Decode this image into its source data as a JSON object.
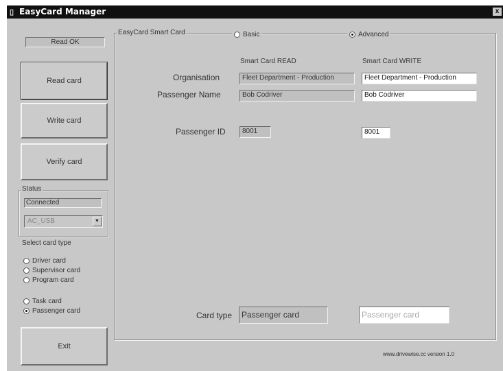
{
  "window": {
    "title": "EasyCard Manager",
    "close_glyph": "x",
    "app_icon": "card-icon"
  },
  "left_panel": {
    "status_line": "Read OK",
    "buttons": {
      "read": "Read card",
      "write": "Write card",
      "verify": "Verify card",
      "exit": "Exit"
    },
    "status_group": {
      "title": "Status",
      "connection": "Connected",
      "port": "AC_USB"
    },
    "card_type_group": {
      "title": "Select card type",
      "options": [
        "Driver card",
        "Supervisor card",
        "Program card",
        "Task card",
        "Passenger card"
      ],
      "selected": "Passenger card"
    }
  },
  "main": {
    "group_title": "EasyCard Smart Card",
    "mode": {
      "basic": "Basic",
      "advanced": "Advanced",
      "selected": "Advanced"
    },
    "col_read": "Smart Card READ",
    "col_write": "Smart Card WRITE",
    "organisation": {
      "label": "Organisation",
      "read": "Fleet Department - Production",
      "write": "Fleet Department - Production"
    },
    "passenger_name": {
      "label": "Passenger Name",
      "read": "Bob Codriver",
      "write": "Bob Codriver"
    },
    "passenger_id": {
      "label": "Passenger ID",
      "read": "8001",
      "write": "8001"
    },
    "card_type": {
      "label": "Card type",
      "read": "Passenger card",
      "write": "Passenger card"
    }
  },
  "footer": {
    "version": "www.drivewise.cc version 1.0"
  }
}
